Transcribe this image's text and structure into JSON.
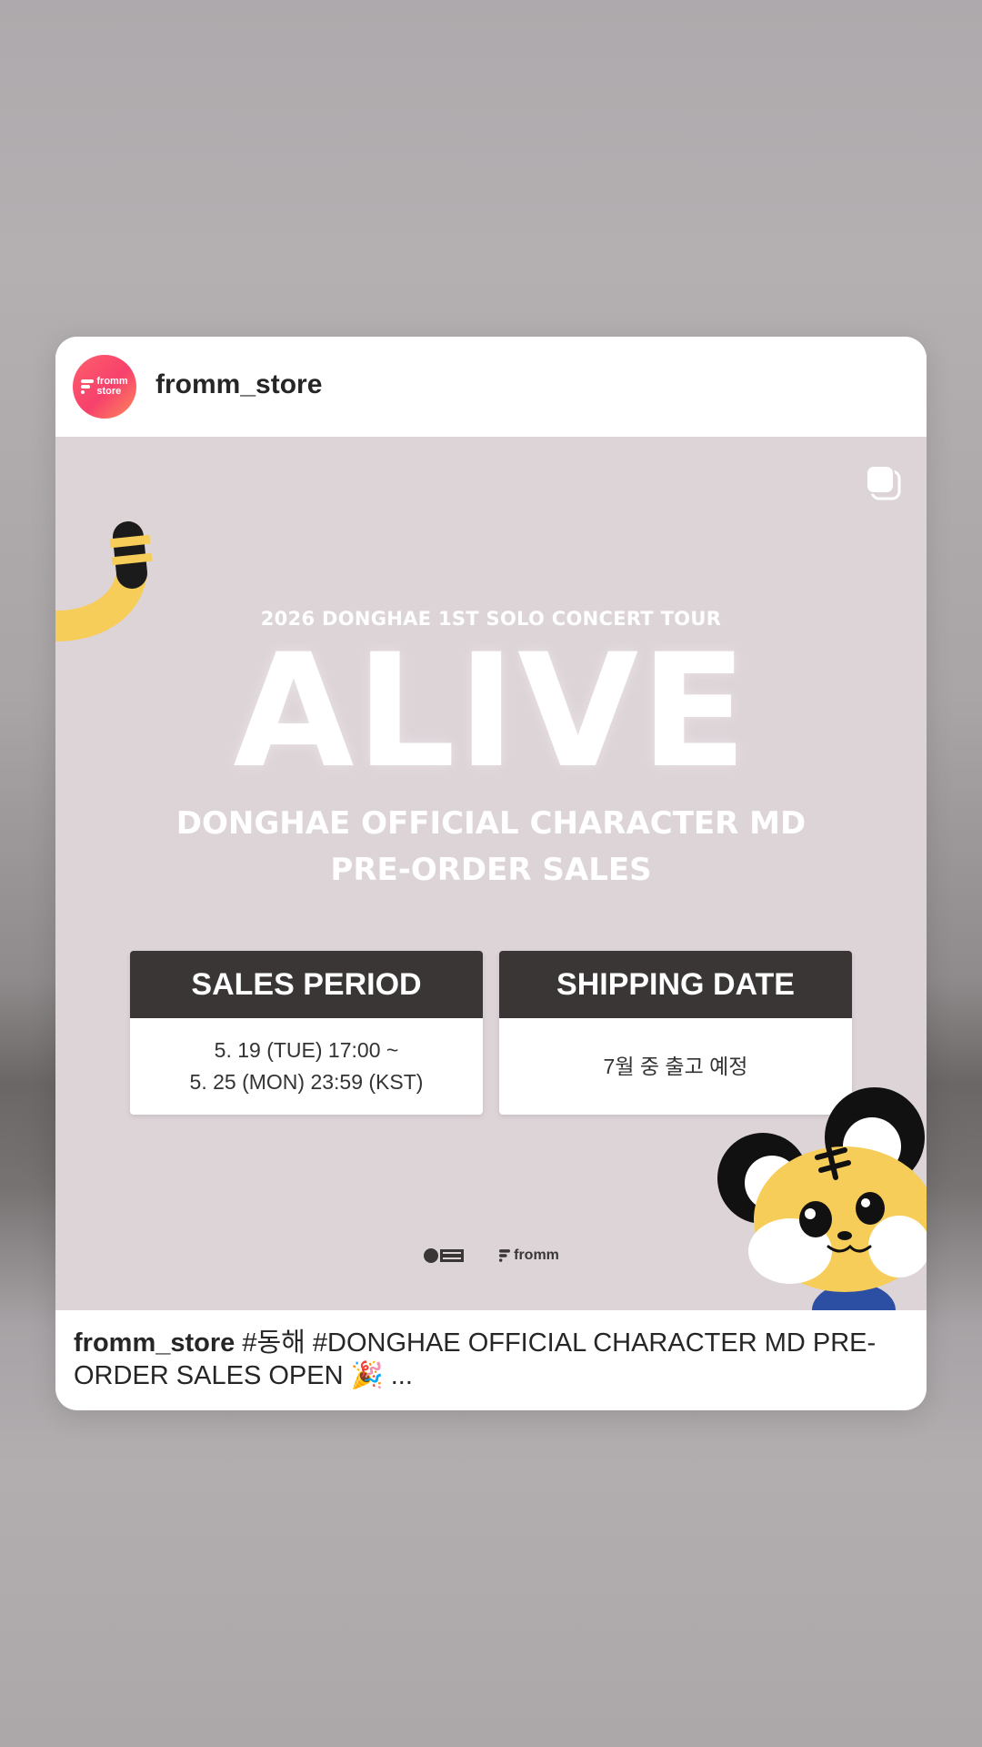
{
  "post": {
    "username": "fromm_store",
    "avatar_logo_text": "fromm\nstore",
    "image": {
      "concert_title": "2026 DONGHAE 1ST SOLO CONCERT TOUR",
      "main_title": "ALIVE",
      "subtitle_line1": "DONGHAE OFFICIAL CHARACTER MD",
      "subtitle_line2": "PRE-ORDER SALES",
      "sales_period": {
        "heading": "SALES PERIOD",
        "line1": "5. 19 (TUE) 17:00 ~",
        "line2": "5. 25 (MON) 23:59 (KST)"
      },
      "shipping_date": {
        "heading": "SHIPPING DATE",
        "line1": "7월 중 출고 예정"
      },
      "partner_logo_2": "fromm"
    },
    "caption": {
      "username": "fromm_store",
      "text": " #동해 #DONGHAE OFFICIAL CHARACTER MD PRE-ORDER SALES OPEN 🎉 ..."
    }
  },
  "colors": {
    "avatar_gradient_start": "#ff5f6d",
    "image_background": "#ddd4d8",
    "box_header": "#3a3636",
    "tiger_yellow": "#f7cd5a"
  },
  "icons": {
    "multi_post": "square-stack-icon",
    "tail": "tiger-tail-illustration",
    "character": "tiger-character-illustration"
  }
}
